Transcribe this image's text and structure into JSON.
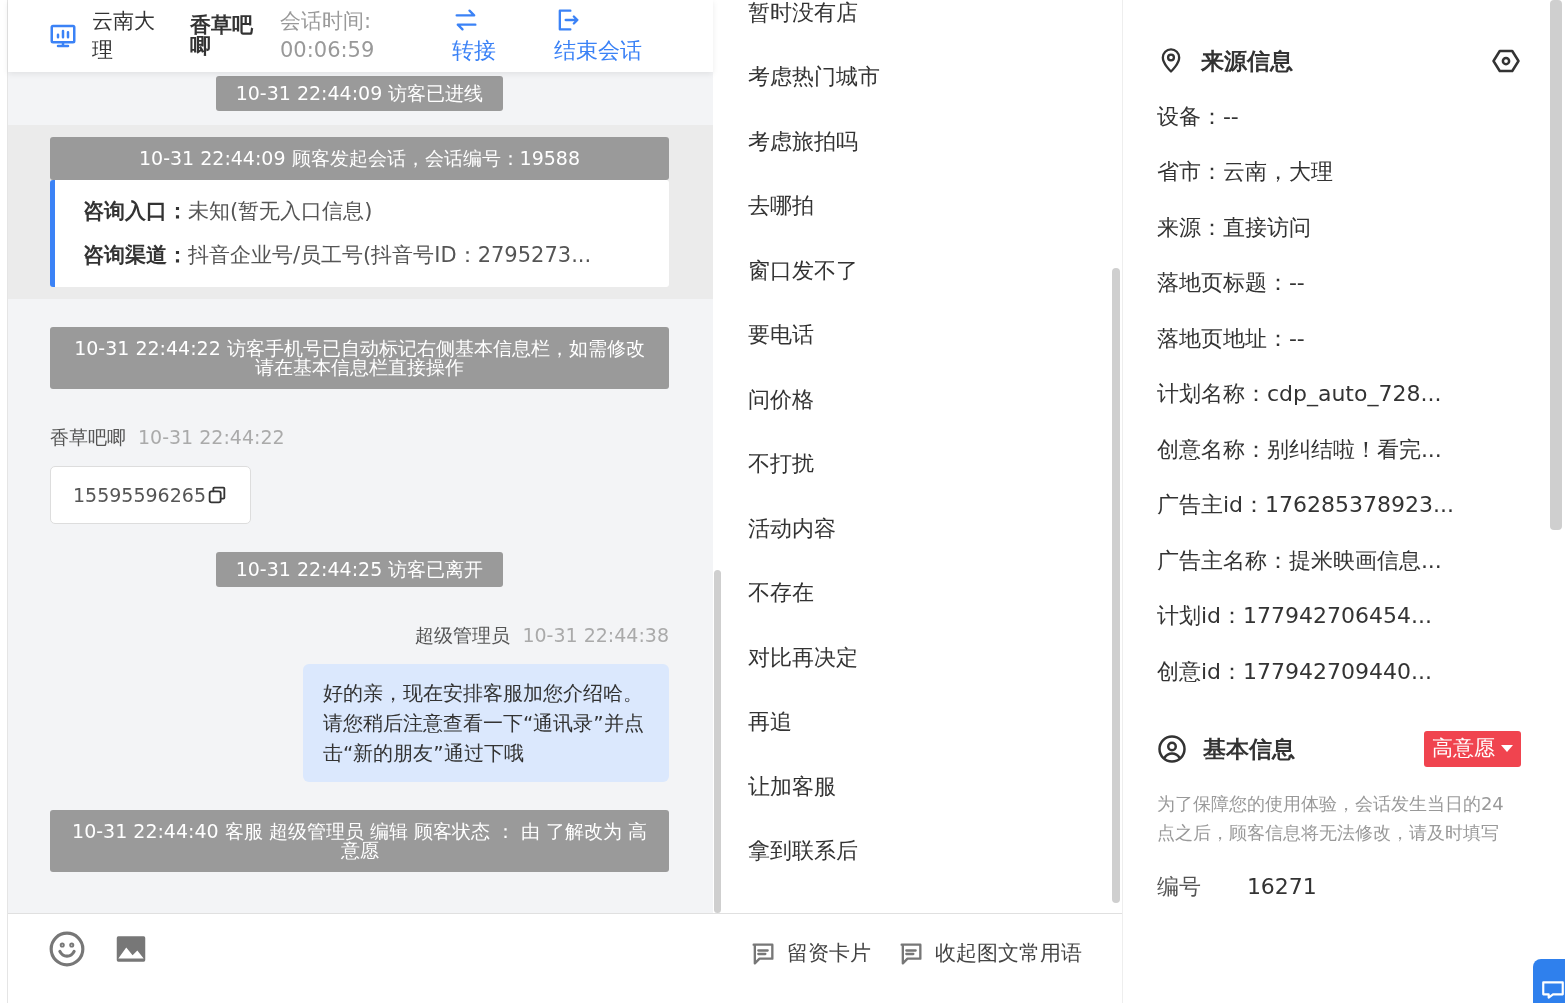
{
  "header": {
    "location": "云南大理",
    "customer": "香草吧唧",
    "timer_label": "会话时间:",
    "timer": "00:06:59",
    "actions": [
      {
        "kind": "transfer",
        "label": "转接"
      },
      {
        "kind": "end",
        "label": "结束会话"
      }
    ]
  },
  "messages": [
    {
      "kind": "system",
      "highlighted": false,
      "text": "10-31 22:44:09 访客已进线"
    },
    {
      "kind": "system",
      "highlighted": true,
      "text": "10-31 22:44:09 顾客发起会话，会话编号：19588"
    },
    {
      "kind": "info",
      "highlighted": true,
      "rows": [
        {
          "label": "咨询入口：",
          "value": "未知(暂无入口信息)"
        },
        {
          "label": "咨询渠道：",
          "value": "抖音企业号/员工号(抖音号ID：2795273..."
        }
      ]
    },
    {
      "kind": "system",
      "highlighted": false,
      "text": "10-31 22:44:22 访客手机号已自动标记右侧基本信息栏，如需修改请在基本信息栏直接操作"
    },
    {
      "kind": "contact",
      "highlighted": false,
      "sender": "香草吧唧",
      "time": "10-31 22:44:22",
      "text": "15595596265"
    },
    {
      "kind": "system",
      "highlighted": false,
      "text": "10-31 22:44:25 访客已离开"
    },
    {
      "kind": "agent",
      "highlighted": false,
      "sender": "超级管理员",
      "time": "10-31 22:44:38",
      "text": "好的亲，现在安排客服加您介绍哈。请您稍后注意查看一下“通讯录”并点击“新的朋友”通过下哦"
    },
    {
      "kind": "system",
      "highlighted": false,
      "text": "10-31 22:44:40 客服 超级管理员 编辑 顾客状态 ： 由 了解改为 高意愿"
    }
  ],
  "quick_replies": [
    "暂时没有店",
    "考虑热门城市",
    "考虑旅拍吗",
    "去哪拍",
    "窗口发不了",
    "要电话",
    "问价格",
    "不打扰",
    "活动内容",
    "不存在",
    "对比再决定",
    "再追",
    "让加客服",
    "拿到联系后"
  ],
  "toolbar": {
    "buttons": [
      {
        "label": "留资卡片"
      },
      {
        "label": "收起图文常用语"
      }
    ]
  },
  "source_info": {
    "title": "来源信息",
    "fields": [
      "设备：--",
      "省市：云南，大理",
      "来源：直接访问",
      "落地页标题：--",
      "落地页地址：--",
      "计划名称：cdp_auto_728...",
      "创意名称：别纠结啦！看完...",
      "广告主id：176285378923...",
      "广告主名称：提米映画信息...",
      "计划id：177942706454...",
      "创意id：177942709440..."
    ]
  },
  "basic_info": {
    "title": "基本信息",
    "intent": "高意愿",
    "notice": "为了保障您的使用体验，会话发生当日的24点之后，顾客信息将无法修改，请及时填写",
    "fields": [
      {
        "label": "编号",
        "value": "16271"
      }
    ]
  }
}
